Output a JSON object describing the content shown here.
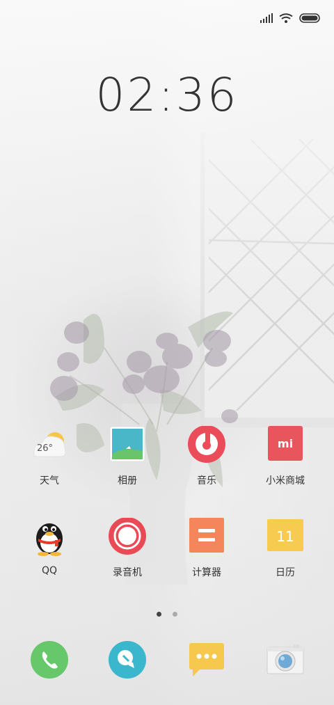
{
  "status_bar": {
    "signal_icon": "cellular-signal-icon",
    "wifi_icon": "wifi-icon",
    "battery_icon": "battery-icon"
  },
  "clock": {
    "time": "02:36"
  },
  "weather": {
    "temp": "26°"
  },
  "apps_row1": [
    {
      "label": "天气",
      "icon": "weather-icon"
    },
    {
      "label": "相册",
      "icon": "gallery-icon"
    },
    {
      "label": "音乐",
      "icon": "music-icon"
    },
    {
      "label": "小米商城",
      "icon": "mi-store-icon"
    }
  ],
  "apps_row2": [
    {
      "label": "QQ",
      "icon": "qq-penguin-icon"
    },
    {
      "label": "录音机",
      "icon": "recorder-icon"
    },
    {
      "label": "计算器",
      "icon": "calculator-icon"
    },
    {
      "label": "日历",
      "icon": "calendar-icon"
    }
  ],
  "calendar": {
    "day": "11"
  },
  "mi_logo": "mi",
  "pager": {
    "pages": 2,
    "active": 1
  },
  "dock": [
    {
      "icon": "phone-icon"
    },
    {
      "icon": "browser-icon"
    },
    {
      "icon": "messages-icon"
    },
    {
      "icon": "camera-icon"
    }
  ],
  "colors": {
    "music": "#ea4c5a",
    "mi_store": "#e9555d",
    "recorder": "#ea4a55",
    "calculator": "#f5855b",
    "calendar": "#f7cb4f",
    "phone": "#66c86a",
    "browser": "#3bb7cd",
    "messages": "#f6c84e"
  }
}
